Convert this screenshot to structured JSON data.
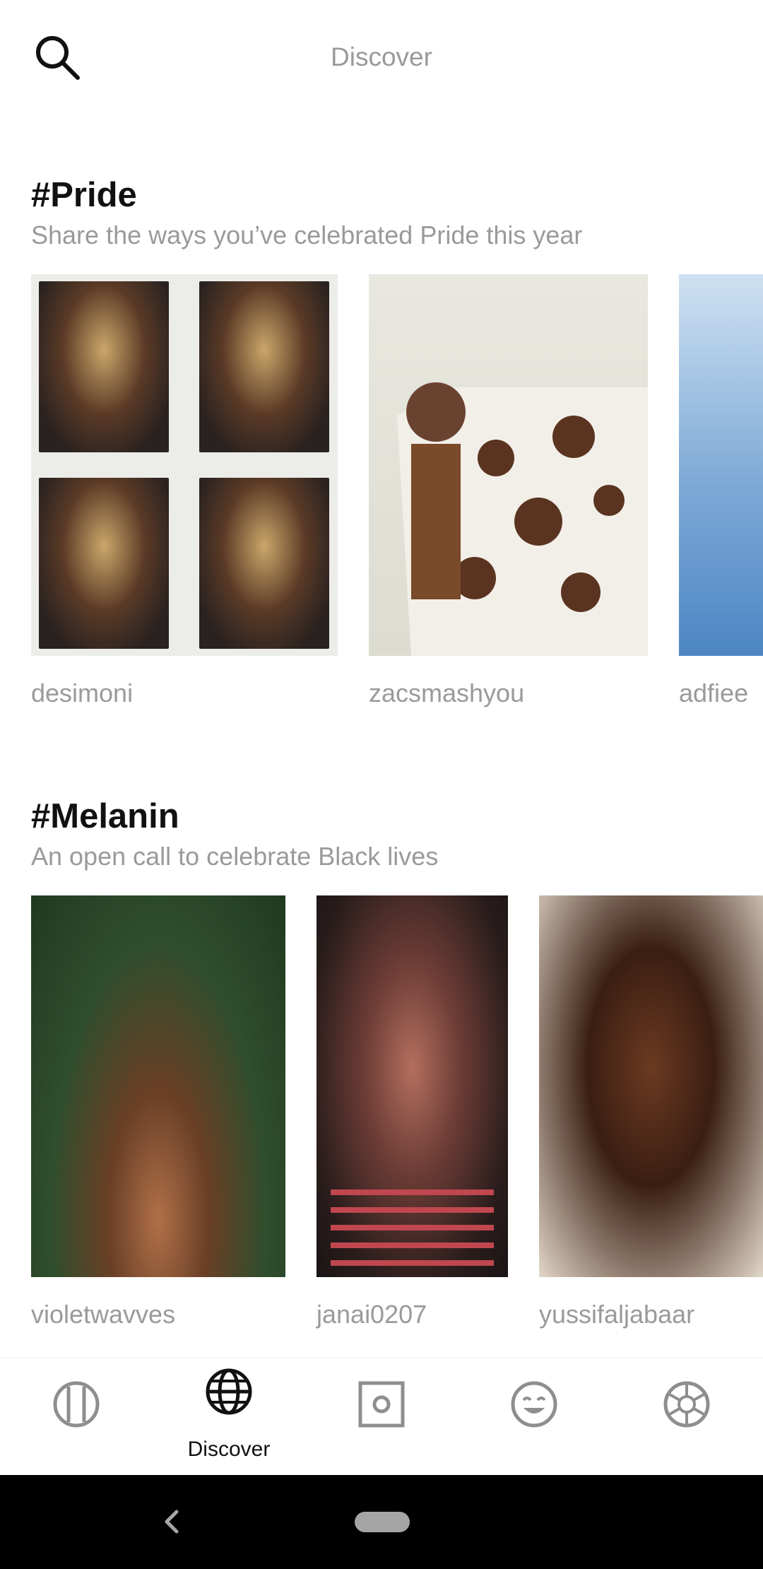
{
  "header": {
    "title": "Discover",
    "search_icon": "search-icon"
  },
  "sections": [
    {
      "title": "#Pride",
      "subtitle": "Share the ways you’ve celebrated Pride this year",
      "posts": [
        {
          "handle": "desimoni"
        },
        {
          "handle": "zacsmashyou"
        },
        {
          "handle": "adfiee"
        }
      ]
    },
    {
      "title": "#Melanin",
      "subtitle": "An open call to celebrate Black lives",
      "posts": [
        {
          "handle": "violetwavves"
        },
        {
          "handle": "janai0207"
        },
        {
          "handle": "yussifaljabaar"
        }
      ]
    }
  ],
  "bottom_nav": {
    "items": [
      {
        "icon": "feed-icon",
        "label": ""
      },
      {
        "icon": "globe-icon",
        "label": "Discover",
        "active": true
      },
      {
        "icon": "capture-icon",
        "label": ""
      },
      {
        "icon": "smiley-icon",
        "label": ""
      },
      {
        "icon": "aperture-icon",
        "label": ""
      }
    ]
  },
  "colors": {
    "text_primary": "#111111",
    "text_secondary": "#9a9a9a",
    "background": "#ffffff",
    "system_bar": "#000000"
  }
}
